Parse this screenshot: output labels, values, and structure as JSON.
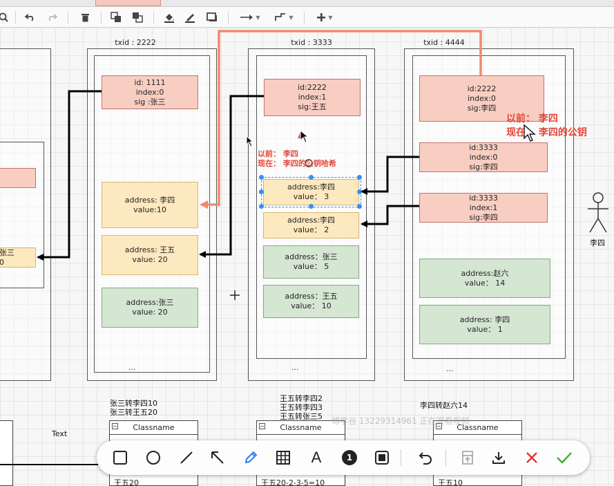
{
  "page": {
    "canvas_texts": {
      "text_label": "Text",
      "stick_figure_label": "李四"
    }
  },
  "panels": [
    {
      "txid": "",
      "boxes": [
        {
          "kind": "yellow",
          "lines": [
            "张三",
            "0"
          ]
        }
      ]
    },
    {
      "txid": "txid : 2222",
      "boxes": [
        {
          "kind": "pink",
          "lines": [
            "id: 1111",
            "index:0",
            "sig :张三"
          ]
        },
        {
          "kind": "yellow",
          "lines": [
            "address: 李四",
            "value:10"
          ]
        },
        {
          "kind": "yellow",
          "lines": [
            "address: 王五",
            "value: 20"
          ]
        },
        {
          "kind": "green",
          "lines": [
            "address:张三",
            "value:  20"
          ]
        }
      ],
      "ellipsis": "...",
      "caption": [
        "张三转李四10",
        "张三转王五20"
      ]
    },
    {
      "txid": "txid : 3333",
      "boxes": [
        {
          "kind": "pink",
          "lines": [
            "id:2222",
            "index:1",
            "sig:王五"
          ]
        },
        {
          "kind": "yellow",
          "lines": [
            "address:李四",
            "value：  3"
          ]
        },
        {
          "kind": "yellow",
          "lines": [
            "address:李四",
            "value：  2"
          ]
        },
        {
          "kind": "green",
          "lines": [
            "address：张三",
            "value：  5"
          ]
        },
        {
          "kind": "green",
          "lines": [
            "address：王五",
            "value：  10"
          ]
        }
      ],
      "ellipsis": "...",
      "caption": [
        "王五转李四2",
        "王五转李四3",
        "王五转张三5"
      ]
    },
    {
      "txid": "txid : 4444",
      "boxes": [
        {
          "kind": "pink",
          "lines": [
            "id:2222",
            "index:0",
            "sig:李四"
          ]
        },
        {
          "kind": "pink",
          "lines": [
            "id:3333",
            "index:0",
            "sig:李四"
          ]
        },
        {
          "kind": "pink",
          "lines": [
            "id:3333",
            "index:1",
            "sig:李四"
          ]
        },
        {
          "kind": "green",
          "lines": [
            "address:赵六",
            "value：  14"
          ]
        },
        {
          "kind": "green",
          "lines": [
            "address: 李四",
            "value：  1"
          ]
        }
      ],
      "ellipsis": "...",
      "caption": [
        "李四转赵六14"
      ]
    }
  ],
  "annotations": [
    {
      "lines": [
        "以前：  李四",
        "现在：  李四的公钥哈希"
      ]
    },
    {
      "lines": [
        "以前：  李四",
        "现在：  李四的公钥"
      ]
    }
  ],
  "class_tables": [
    {
      "header": "Classname",
      "row": "王五20"
    },
    {
      "header": "Classname",
      "row": "王五20-2-3-5=10"
    },
    {
      "header": "Classname",
      "row": "王五10"
    }
  ],
  "watermark": "博学谷 13229314961 正在观看视频",
  "toolbar": {
    "icons": [
      "search-icon",
      "undo-icon",
      "redo-icon",
      "delete-icon",
      "to-front-icon",
      "to-back-icon",
      "fill-color-icon",
      "line-color-icon",
      "shadow-icon",
      "connection-icon",
      "waypoints-icon",
      "insert-icon"
    ]
  },
  "drawbar": {
    "tools": [
      "rectangle",
      "ellipse",
      "line",
      "arrow",
      "pen",
      "mosaic",
      "text",
      "step-number",
      "highlight-box",
      "undo",
      "pin",
      "download",
      "cancel",
      "confirm"
    ],
    "step_number_label": "1",
    "text_tool_label": "A",
    "accent_color": "#2b7de9",
    "cancel_color": "#e0352b",
    "confirm_color": "#3cae3a"
  },
  "colors": {
    "arrow_dark": "#000000",
    "arrow_orange": "#f08a6c",
    "annotation": "#e2473a"
  }
}
